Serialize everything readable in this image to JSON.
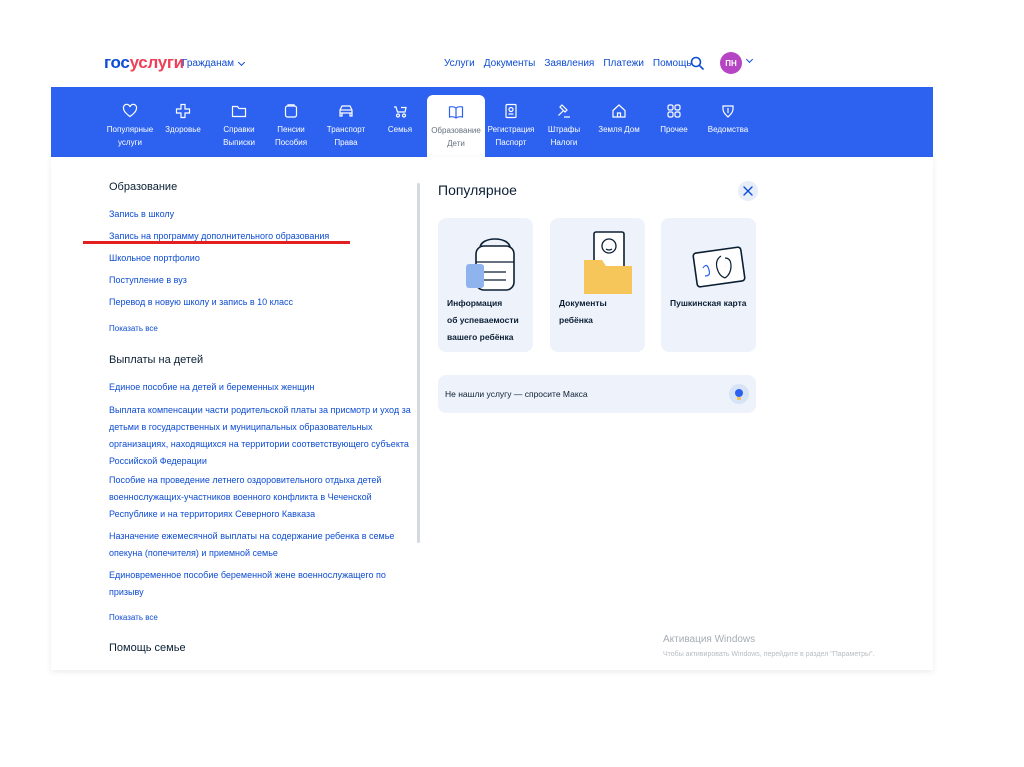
{
  "header": {
    "logo_part1": "гос",
    "logo_part2": "услуги",
    "audience": "Гражданам",
    "nav": [
      "Услуги",
      "Документы",
      "Заявления",
      "Платежи",
      "Помощь"
    ],
    "avatar_initials": "ПН"
  },
  "categories": [
    {
      "line1": "Популярные",
      "line2": "услуги",
      "icon": "heart-icon"
    },
    {
      "line1": "Здоровье",
      "line2": "",
      "icon": "medical-cross-icon"
    },
    {
      "line1": "Справки",
      "line2": "Выписки",
      "icon": "folder-icon"
    },
    {
      "line1": "Пенсии",
      "line2": "Пособия",
      "icon": "wallet-icon"
    },
    {
      "line1": "Транспорт",
      "line2": "Права",
      "icon": "car-icon"
    },
    {
      "line1": "Семья",
      "line2": "",
      "icon": "stroller-icon"
    },
    {
      "line1": "Образование",
      "line2": "Дети",
      "icon": "book-icon"
    },
    {
      "line1": "Регистрация",
      "line2": "Паспорт",
      "icon": "passport-icon"
    },
    {
      "line1": "Штрафы",
      "line2": "Налоги",
      "icon": "gavel-icon"
    },
    {
      "line1": "Земля Дом",
      "line2": "",
      "icon": "house-icon"
    },
    {
      "line1": "Прочее",
      "line2": "",
      "icon": "grid-icon"
    },
    {
      "line1": "Ведомства",
      "line2": "",
      "icon": "emblem-icon"
    }
  ],
  "sections": {
    "education": {
      "title": "Образование",
      "links": [
        "Запись в школу",
        "Запись на программу дополнительного образования",
        "Школьное портфолио",
        "Поступление в вуз",
        "Перевод в новую школу и запись в 10 класс"
      ],
      "more": "Показать все"
    },
    "payments": {
      "title": "Выплаты на детей",
      "link1": "Единое пособие на детей и беременных женщин",
      "link2": [
        "Выплата компенсации части родительской платы за присмотр и уход за",
        "детьми в государственных и муниципальных образовательных",
        "организациях, находящихся на территории соответствующего субъекта",
        "Российской Федерации"
      ],
      "link3": [
        "Пособие на проведение летнего оздоровительного отдыха детей",
        "военнослужащих-участников военного конфликта в Чеченской",
        "Республике и на территориях Северного Кавказа"
      ],
      "link4": [
        "Назначение ежемесячной выплаты на содержание ребенка в семье",
        "опекуна (попечителя) и приемной семье"
      ],
      "link5": [
        "Единовременное пособие беременной жене военнослужащего по",
        "призыву"
      ],
      "more": "Показать все"
    },
    "family": {
      "title": "Помощь семье"
    }
  },
  "popular": {
    "title": "Популярное",
    "cards": [
      {
        "lines": [
          "Информация",
          "об успеваемости",
          "вашего ребёнка"
        ],
        "icon": "backpack-icon"
      },
      {
        "lines": [
          "Документы",
          "ребёнка"
        ],
        "icon": "child-folder-icon"
      },
      {
        "lines": [
          "Пушкинская карта"
        ],
        "icon": "pushkin-card-icon"
      }
    ],
    "ask": "Не нашли услугу — спросите Макса"
  },
  "watermark": {
    "title": "Активация Windows",
    "subtitle": "Чтобы активировать Windows, перейдите в раздел \"Параметры\"."
  },
  "colors": {
    "brand_blue": "#0d4cd3",
    "band_blue": "#2d62f0",
    "logo_red": "#ee3f58",
    "underline_red": "#e31f1f",
    "avatar": "#b545c2"
  }
}
